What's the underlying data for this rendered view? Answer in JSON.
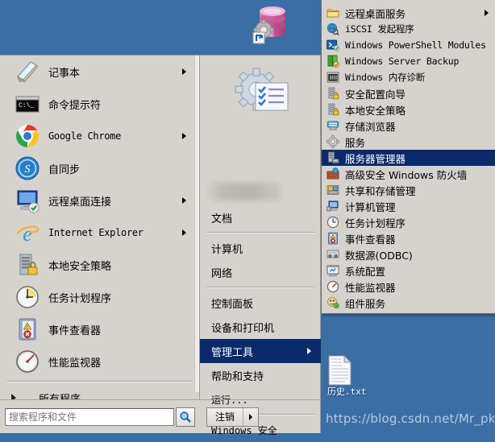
{
  "desktop": {
    "background_color": "#3a6ea5",
    "icons": [
      {
        "name": "database-shortcut",
        "label": "",
        "icon": "database-gear-shortcut-icon"
      },
      {
        "name": "history-text-file",
        "label": "历史.txt",
        "icon": "text-file-icon"
      }
    ],
    "watermark": "https://blog.csdn.net/Mr_pkq"
  },
  "start_menu": {
    "left_panel": {
      "items": [
        {
          "label": "记事本",
          "icon": "notepad-icon",
          "has_submenu": true,
          "mono": false
        },
        {
          "label": "命令提示符",
          "icon": "command-prompt-icon",
          "has_submenu": false,
          "mono": false
        },
        {
          "label": "Google Chrome",
          "icon": "chrome-icon",
          "has_submenu": true,
          "mono": true
        },
        {
          "label": "自同步",
          "icon": "sync-icon",
          "has_submenu": false,
          "mono": false
        },
        {
          "label": "远程桌面连接",
          "icon": "remote-desktop-icon",
          "has_submenu": true,
          "mono": false
        },
        {
          "label": "Internet Explorer",
          "icon": "internet-explorer-icon",
          "has_submenu": true,
          "mono": true
        },
        {
          "label": "本地安全策略",
          "icon": "local-security-policy-icon",
          "has_submenu": false,
          "mono": false
        },
        {
          "label": "任务计划程序",
          "icon": "task-scheduler-icon",
          "has_submenu": false,
          "mono": false
        },
        {
          "label": "事件查看器",
          "icon": "event-viewer-icon",
          "has_submenu": false,
          "mono": false
        },
        {
          "label": "性能监视器",
          "icon": "performance-monitor-icon",
          "has_submenu": false,
          "mono": false
        }
      ],
      "all_programs": "所有程序",
      "search": {
        "placeholder": "搜索程序和文件",
        "value": "",
        "button_icon": "search-icon"
      }
    },
    "middle_panel": {
      "user_picture_icon": "gear-checklist-icon",
      "user_name": "",
      "items": [
        {
          "label": "文档",
          "selected": false,
          "has_submenu": false,
          "sep_after": true,
          "mono": false
        },
        {
          "label": "计算机",
          "selected": false,
          "has_submenu": false,
          "sep_after": false,
          "mono": false
        },
        {
          "label": "网络",
          "selected": false,
          "has_submenu": false,
          "sep_after": true,
          "mono": false
        },
        {
          "label": "控制面板",
          "selected": false,
          "has_submenu": false,
          "sep_after": false,
          "mono": false
        },
        {
          "label": "设备和打印机",
          "selected": false,
          "has_submenu": false,
          "sep_after": false,
          "mono": false
        },
        {
          "label": "管理工具",
          "selected": true,
          "has_submenu": true,
          "sep_after": false,
          "mono": false
        },
        {
          "label": "帮助和支持",
          "selected": false,
          "has_submenu": false,
          "sep_after": false,
          "mono": false
        },
        {
          "label": "运行...",
          "selected": false,
          "has_submenu": false,
          "sep_after": true,
          "mono": false
        },
        {
          "label": "Windows 安全",
          "selected": false,
          "has_submenu": false,
          "sep_after": false,
          "mono": true
        }
      ],
      "logoff": {
        "label": "注销",
        "has_menu": true
      }
    },
    "submenu": {
      "title": "管理工具",
      "items": [
        {
          "label": "远程桌面服务",
          "icon": "folder-icon",
          "selected": false,
          "has_submenu": true,
          "mono": false
        },
        {
          "label": "iSCSI 发起程序",
          "icon": "iscsi-initiator-icon",
          "selected": false,
          "has_submenu": false,
          "mono": true
        },
        {
          "label": "Windows PowerShell Modules",
          "icon": "powershell-icon",
          "selected": false,
          "has_submenu": false,
          "mono": true
        },
        {
          "label": "Windows Server Backup",
          "icon": "server-backup-icon",
          "selected": false,
          "has_submenu": false,
          "mono": true
        },
        {
          "label": "Windows 内存诊断",
          "icon": "memory-diagnostic-icon",
          "selected": false,
          "has_submenu": false,
          "mono": true
        },
        {
          "label": "安全配置向导",
          "icon": "security-configuration-wizard-icon",
          "selected": false,
          "has_submenu": false,
          "mono": false
        },
        {
          "label": "本地安全策略",
          "icon": "local-security-policy-icon",
          "selected": false,
          "has_submenu": false,
          "mono": false
        },
        {
          "label": "存储浏览器",
          "icon": "storage-explorer-icon",
          "selected": false,
          "has_submenu": false,
          "mono": false
        },
        {
          "label": "服务",
          "icon": "services-icon",
          "selected": false,
          "has_submenu": false,
          "mono": false
        },
        {
          "label": "服务器管理器",
          "icon": "server-manager-icon",
          "selected": true,
          "has_submenu": false,
          "mono": false
        },
        {
          "label": "高级安全 Windows 防火墙",
          "icon": "firewall-icon",
          "selected": false,
          "has_submenu": false,
          "mono": false
        },
        {
          "label": "共享和存储管理",
          "icon": "share-storage-management-icon",
          "selected": false,
          "has_submenu": false,
          "mono": false
        },
        {
          "label": "计算机管理",
          "icon": "computer-management-icon",
          "selected": false,
          "has_submenu": false,
          "mono": false
        },
        {
          "label": "任务计划程序",
          "icon": "task-scheduler-icon",
          "selected": false,
          "has_submenu": false,
          "mono": false
        },
        {
          "label": "事件查看器",
          "icon": "event-viewer-icon",
          "selected": false,
          "has_submenu": false,
          "mono": false
        },
        {
          "label": "数据源(ODBC)",
          "icon": "odbc-data-source-icon",
          "selected": false,
          "has_submenu": false,
          "mono": false
        },
        {
          "label": "系统配置",
          "icon": "system-configuration-icon",
          "selected": false,
          "has_submenu": false,
          "mono": false
        },
        {
          "label": "性能监视器",
          "icon": "performance-monitor-icon",
          "selected": false,
          "has_submenu": false,
          "mono": false
        },
        {
          "label": "组件服务",
          "icon": "component-services-icon",
          "selected": false,
          "has_submenu": false,
          "mono": false
        }
      ]
    }
  },
  "colors": {
    "desktop_blue": "#3a6ea5",
    "menu_bg": "#d6d3ce",
    "highlight": "#0b2a6b",
    "highlight_text": "#ffffff",
    "text": "#000000"
  }
}
